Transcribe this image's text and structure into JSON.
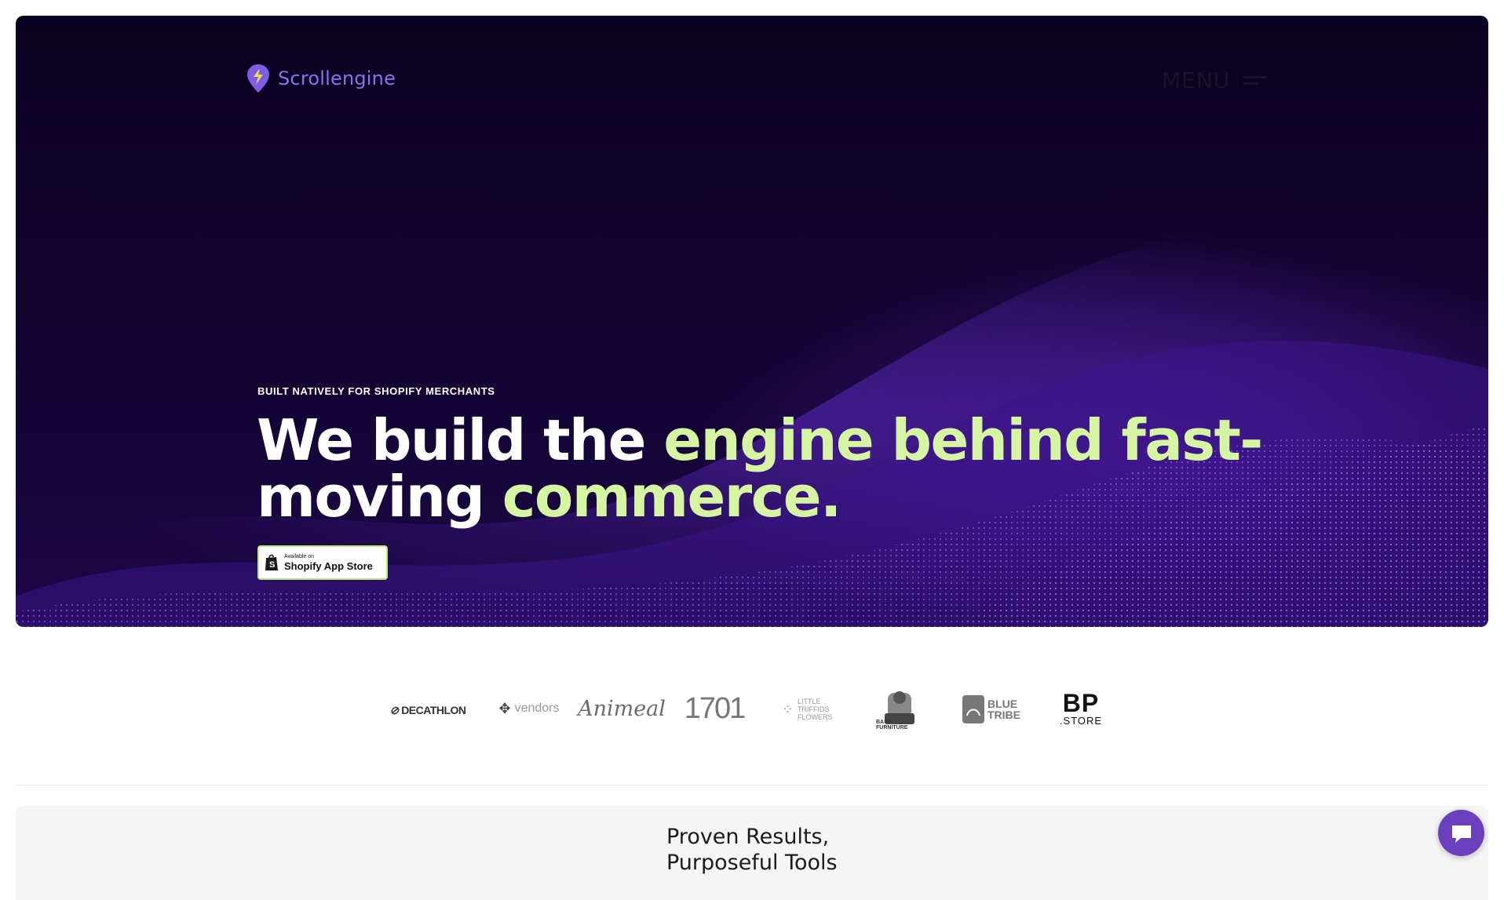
{
  "header": {
    "logo_text": "Scrollengine",
    "logo_icon": "lightning-pin-icon",
    "menu_label": "MENU",
    "menu_icon": "hamburger-icon"
  },
  "hero": {
    "eyebrow": "BUILT NATIVELY FOR SHOPIFY MERCHANTS",
    "headline_part1": "We build the ",
    "headline_accent1": "engine behind fast-",
    "headline_part2": "moving ",
    "headline_accent2": "commerce.",
    "badge_small": "Available on",
    "badge_label": "Shopify App Store"
  },
  "brands": [
    {
      "name": "DECATHLON"
    },
    {
      "name": "vendors"
    },
    {
      "name": "Animeal"
    },
    {
      "name": "1701"
    },
    {
      "name": "LITTLE TRIFFIDS FLOWERS"
    },
    {
      "name": "BASH FURNITURE"
    },
    {
      "name": "BLUE TRIBE"
    },
    {
      "name": "BP",
      "sub": ".STORE"
    }
  ],
  "section": {
    "title_line1": "Proven Results,",
    "title_line2": "Purposeful Tools"
  },
  "colors": {
    "accent_green": "#d6f5a3",
    "brand_purple": "#8c71ef",
    "chat_purple": "#6b3fbd"
  }
}
